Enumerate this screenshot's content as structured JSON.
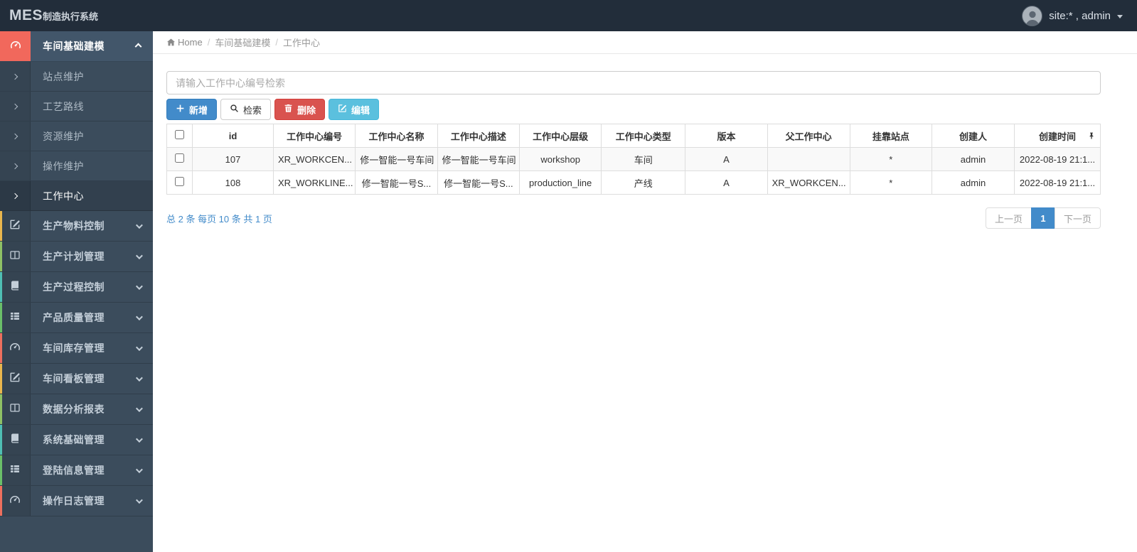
{
  "topbar": {
    "logo_main": "MES",
    "logo_sub": "制造执行系统",
    "user_label": "site:* , admin"
  },
  "breadcrumb": {
    "home": "Home",
    "separator": "/",
    "level1": "车间基础建模",
    "level2": "工作中心"
  },
  "sidebar": {
    "active_group": {
      "label": "车间基础建模",
      "icon": "gauge-icon",
      "icon_bg": "#f1685c"
    },
    "submenu": [
      {
        "label": "站点维护"
      },
      {
        "label": "工艺路线"
      },
      {
        "label": "资源维护"
      },
      {
        "label": "操作维护"
      },
      {
        "label": "工作中心"
      }
    ],
    "groups": [
      {
        "label": "生产物料控制",
        "icon": "pencil-square-icon",
        "stripe": "#e9b64d"
      },
      {
        "label": "生产计划管理",
        "icon": "columns-icon",
        "stripe": "#8ec165"
      },
      {
        "label": "生产过程控制",
        "icon": "book-icon",
        "stripe": "#4fbfb4"
      },
      {
        "label": "产品质量管理",
        "icon": "th-list-icon",
        "stripe": "#6abf69"
      },
      {
        "label": "车间库存管理",
        "icon": "gauge-icon",
        "stripe": "#ee6f5e"
      },
      {
        "label": "车间看板管理",
        "icon": "pencil-square-icon",
        "stripe": "#e9b64d"
      },
      {
        "label": "数据分析报表",
        "icon": "columns-icon",
        "stripe": "#8ec165"
      },
      {
        "label": "系统基础管理",
        "icon": "book-icon",
        "stripe": "#4fbfb4"
      },
      {
        "label": "登陆信息管理",
        "icon": "th-list-icon",
        "stripe": "#6abf69"
      },
      {
        "label": "操作日志管理",
        "icon": "gauge-icon",
        "stripe": "#ee6f5e"
      }
    ]
  },
  "toolbar": {
    "search_placeholder": "请输入工作中心编号检索",
    "add_label": "新增",
    "search_label": "检索",
    "delete_label": "删除",
    "edit_label": "编辑"
  },
  "table": {
    "columns": [
      "id",
      "工作中心编号",
      "工作中心名称",
      "工作中心描述",
      "工作中心层级",
      "工作中心类型",
      "版本",
      "父工作中心",
      "挂靠站点",
      "创建人",
      "创建时间"
    ],
    "rows": [
      [
        "107",
        "XR_WORKCEN...",
        "修一智能一号车间",
        "修一智能一号车间",
        "workshop",
        "车间",
        "A",
        "",
        "*",
        "admin",
        "2022-08-19 21:1..."
      ],
      [
        "108",
        "XR_WORKLINE...",
        "修一智能一号S...",
        "修一智能一号S...",
        "production_line",
        "产线",
        "A",
        "XR_WORKCEN...",
        "*",
        "admin",
        "2022-08-19 21:1..."
      ]
    ]
  },
  "pagination": {
    "summary": "总 2 条 每页 10 条 共 1 页",
    "prev_label": "上一页",
    "current_page": "1",
    "next_label": "下一页"
  },
  "colors": {
    "topbar_bg": "#222d3a",
    "sidebar_bg": "#3b4c5c",
    "accent_blue": "#428bca",
    "danger_red": "#d9534f",
    "info_cyan": "#5bc0de",
    "active_icon_bg": "#f1685c"
  }
}
